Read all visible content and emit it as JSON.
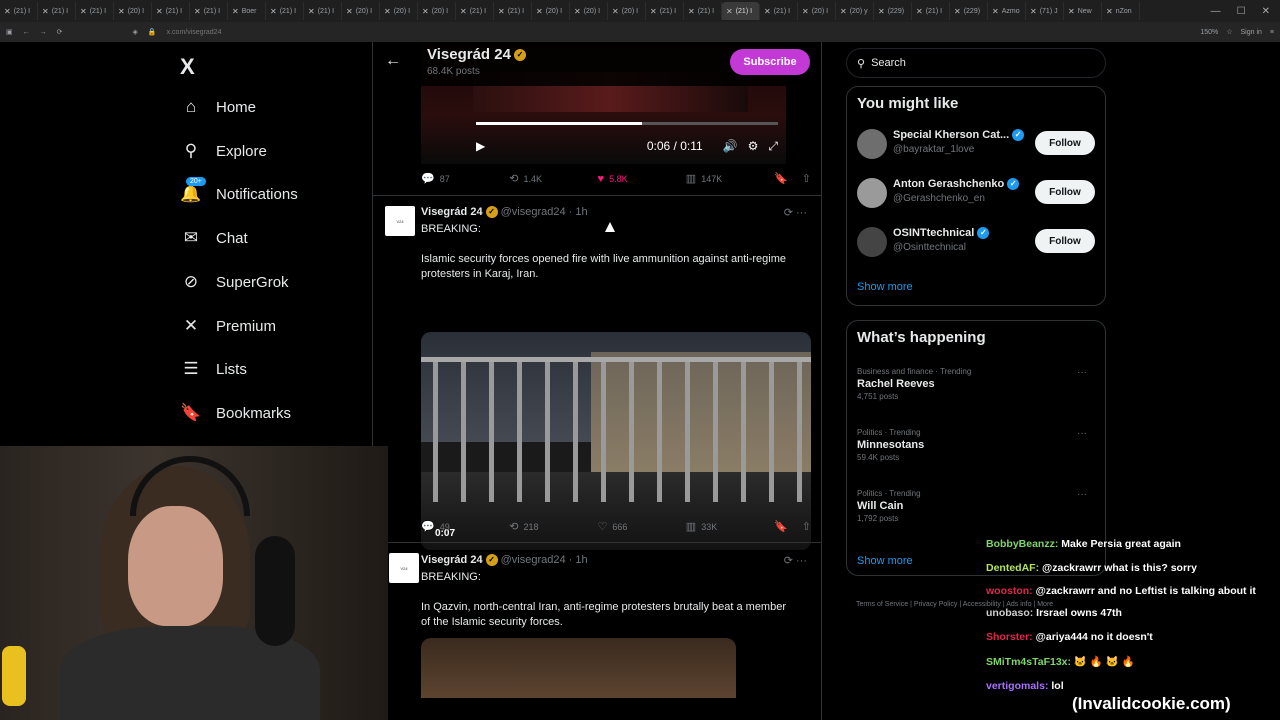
{
  "browser": {
    "tabs": [
      "(21) I",
      "(21) I",
      "(21) I",
      "(20) I",
      "(21) I",
      "(21) I",
      "Boer",
      "(21) I",
      "(21) I",
      "(20) I",
      "(20) I",
      "(20) I",
      "(21) I",
      "(21) I",
      "(20) I",
      "(20) I",
      "(20) I",
      "(21) I",
      "(21) I",
      "(21) I",
      "(21) I",
      "(20) I",
      "(20) y",
      "(229)",
      "(21) I",
      "(229)",
      "Azmo",
      "(71) J",
      "New",
      "nZon"
    ],
    "active_tab_index": 19,
    "address": "x.com/visegrad24",
    "zoom": "150%",
    "signin": "Sign in"
  },
  "sidebar": {
    "logo": "X",
    "notifications_badge": "20+",
    "items": [
      {
        "label": "Home",
        "icon": "home-icon"
      },
      {
        "label": "Explore",
        "icon": "search-icon"
      },
      {
        "label": "Notifications",
        "icon": "bell-icon"
      },
      {
        "label": "Chat",
        "icon": "mail-icon"
      },
      {
        "label": "SuperGrok",
        "icon": "grok-icon"
      },
      {
        "label": "Premium",
        "icon": "x-icon"
      },
      {
        "label": "Lists",
        "icon": "list-icon"
      },
      {
        "label": "Bookmarks",
        "icon": "bookmark-icon"
      }
    ]
  },
  "profile_header": {
    "name": "Visegrád 24",
    "posts": "68.4K posts",
    "subscribe_label": "Subscribe"
  },
  "video1": {
    "time": "0:06 / 0:11",
    "progress": 0.55,
    "stats": {
      "replies": "87",
      "reposts": "1.4K",
      "likes": "5.8K",
      "views": "147K"
    }
  },
  "tweets": [
    {
      "name": "Visegrád 24",
      "handle": "@visegrad24 · 1h",
      "line1": "BREAKING:",
      "body": "Islamic security forces opened fire with live ammunition against anti-regime protesters in Karaj, Iran.",
      "media_time": "0:07",
      "stats": {
        "replies": "49",
        "reposts": "218",
        "likes": "666",
        "views": "33K"
      }
    },
    {
      "name": "Visegrád 24",
      "handle": "@visegrad24 · 1h",
      "line1": "BREAKING:",
      "body": "In Qazvin, north-central Iran, anti-regime protesters brutally beat a member of the Islamic security forces."
    }
  ],
  "right": {
    "search_placeholder": "Search",
    "might_like_title": "You might like",
    "suggestions": [
      {
        "name": "Special Kherson Cat...",
        "handle": "@bayraktar_1love",
        "follow": "Follow"
      },
      {
        "name": "Anton Gerashchenko",
        "handle": "@Gerashchenko_en",
        "follow": "Follow"
      },
      {
        "name": "OSINTtechnical",
        "handle": "@Osinttechnical",
        "follow": "Follow"
      }
    ],
    "show_more": "Show more",
    "happening_title": "What’s happening",
    "trends": [
      {
        "category": "Business and finance · Trending",
        "title": "Rachel Reeves",
        "posts": "4,751 posts"
      },
      {
        "category": "Politics · Trending",
        "title": "Minnesotans",
        "posts": "59.4K posts"
      },
      {
        "category": "Politics · Trending",
        "title": "Will Cain",
        "posts": "1,792 posts"
      }
    ],
    "show_more_2": "Show more",
    "footer": [
      "Terms of Service",
      "Privacy Policy",
      "Accessibility",
      "Ads info",
      "More"
    ]
  },
  "chat": [
    {
      "user": "BobbyBeanzz:",
      "color": "#7fd66b",
      "text": "Make Persia great again"
    },
    {
      "user": "DentedAF:",
      "color": "#b7e35a",
      "text": "@zackrawrr what is this? sorry"
    },
    {
      "user": "wooston:",
      "color": "#e0264b",
      "text": "@zackrawrr and no Leftist is talking about it"
    },
    {
      "user": "unobaso:",
      "color": "#cfcfcf",
      "text": "Irsrael owns 47th"
    },
    {
      "user": "Shorster:",
      "color": "#e0264b",
      "text": "@ariya444 no it doesn't"
    },
    {
      "user": "SMiTm4sTaF13x:",
      "color": "#7fd66b",
      "text": "🐱 🔥 🐱 🔥"
    },
    {
      "user": "vertigomals:",
      "color": "#a970ff",
      "text": "lol"
    }
  ],
  "watermark": "(Invalidcookie.com)"
}
